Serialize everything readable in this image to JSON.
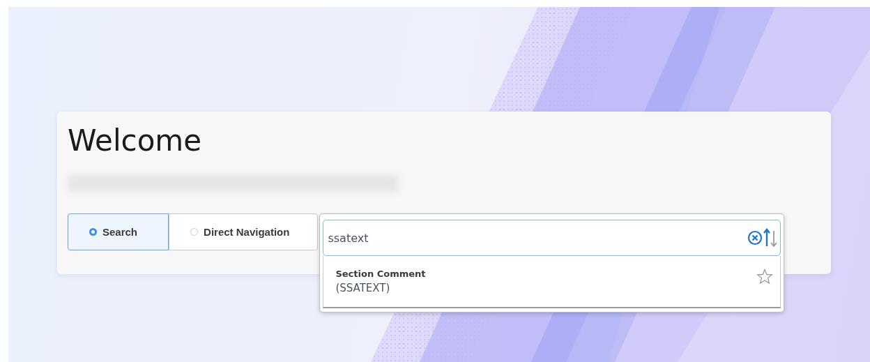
{
  "title": "Welcome",
  "modes": [
    {
      "label": "Search",
      "selected": true
    },
    {
      "label": "Direct Navigation",
      "selected": false
    }
  ],
  "search": {
    "value": "ssatext"
  },
  "results": [
    {
      "title": "Section Comment",
      "code": "(SSATEXT)",
      "favorite": false
    }
  ]
}
